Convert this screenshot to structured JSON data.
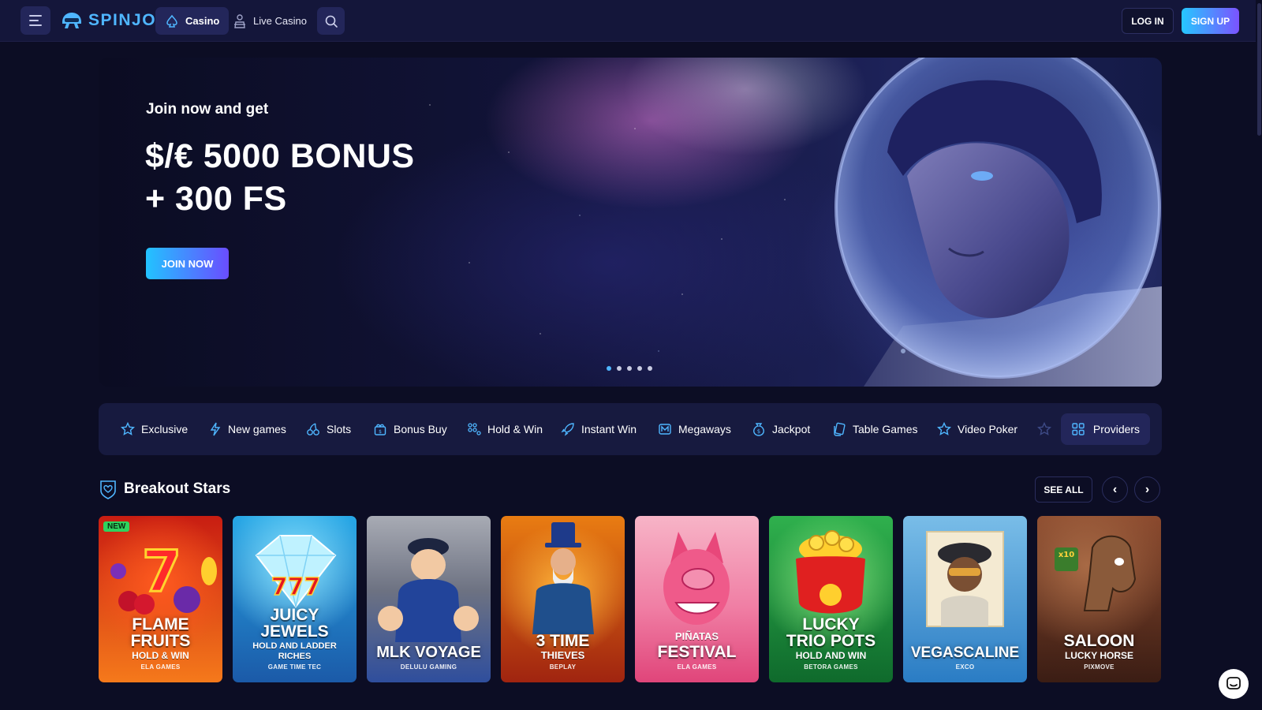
{
  "header": {
    "brand": "SPINJO",
    "nav": [
      {
        "label": "Casino",
        "icon": "spade-icon",
        "active": true
      },
      {
        "label": "Live Casino",
        "icon": "dealer-icon",
        "active": false
      }
    ],
    "login_label": "LOG IN",
    "signup_label": "SIGN UP"
  },
  "hero": {
    "subtitle": "Join now and get",
    "title_line1": "$/€ 5000 BONUS",
    "title_line2": "+ 300 FS",
    "cta_label": "JOIN NOW",
    "slides_total": 5,
    "active_slide": 1
  },
  "categories": [
    {
      "label": "Exclusive",
      "icon": "star-icon"
    },
    {
      "label": "New games",
      "icon": "bolt-icon"
    },
    {
      "label": "Slots",
      "icon": "cherries-icon"
    },
    {
      "label": "Bonus Buy",
      "icon": "gift-icon"
    },
    {
      "label": "Hold & Win",
      "icon": "grid-dots-icon"
    },
    {
      "label": "Instant Win",
      "icon": "rocket-icon"
    },
    {
      "label": "Megaways",
      "icon": "m-icon"
    },
    {
      "label": "Jackpot",
      "icon": "coin-bag-icon"
    },
    {
      "label": "Table Games",
      "icon": "cards-icon"
    },
    {
      "label": "Video Poker",
      "icon": "star-icon"
    }
  ],
  "providers_label": "Providers",
  "section": {
    "title": "Breakout Stars",
    "see_all_label": "SEE ALL",
    "prev_label": "‹",
    "next_label": "›"
  },
  "games": [
    {
      "title1": "FLAME",
      "title2": "FRUITS",
      "sub": "HOLD & WIN",
      "provider": "ELA GAMES",
      "badge": "NEW",
      "colors": [
        "#c81d12",
        "#f5791b"
      ]
    },
    {
      "title1": "JUICY",
      "title2": "JEWELS",
      "sub": "HOLD AND LADDER RICHES",
      "provider": "GAME TIME TEC",
      "badge": "",
      "colors": [
        "#27a7e6",
        "#1b5aa8"
      ]
    },
    {
      "title1": "",
      "title2": "MLK VOYAGE",
      "sub": "",
      "provider": "DELULU GAMING",
      "badge": "",
      "colors": [
        "#a8abb4",
        "#2f4e9d"
      ]
    },
    {
      "title1": "",
      "title2": "3 TIME",
      "sub": "THIEVES",
      "provider": "BEPLAY",
      "badge": "",
      "colors": [
        "#e97c12",
        "#a02410"
      ]
    },
    {
      "title1": "PIÑATAS",
      "title2": "FESTIVAL",
      "sub": "",
      "provider": "ELA GAMES",
      "badge": "",
      "colors": [
        "#f7b4c7",
        "#e0457a"
      ]
    },
    {
      "title1": "LUCKY",
      "title2": "TRIO POTS",
      "sub": "HOLD AND WIN",
      "provider": "BETORA GAMES",
      "badge": "",
      "colors": [
        "#2fb04d",
        "#0f6a2c"
      ]
    },
    {
      "title1": "",
      "title2": "VEGASCALINE",
      "sub": "",
      "provider": "EXCO",
      "badge": "",
      "colors": [
        "#79bde8",
        "#2a7cc4"
      ]
    },
    {
      "title1": "",
      "title2": "SALOON",
      "sub": "LUCKY HORSE",
      "provider": "PIXMOVE",
      "badge": "",
      "colors": [
        "#8b4a2e",
        "#3b1d14"
      ]
    }
  ],
  "colors": {
    "accent": "#4fb6ff",
    "gradient_start": "#22c3ff",
    "gradient_end": "#6a4dff",
    "bg": "#0c0d24",
    "panel": "#171a3f"
  }
}
